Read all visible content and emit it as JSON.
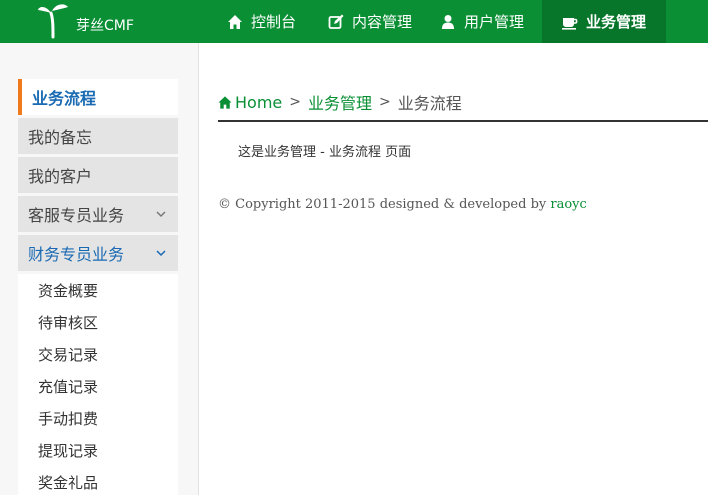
{
  "brand": {
    "name": "芽丝CMF"
  },
  "nav": [
    {
      "label": "控制台",
      "icon": "home-icon"
    },
    {
      "label": "内容管理",
      "icon": "edit-icon"
    },
    {
      "label": "用户管理",
      "icon": "user-icon"
    },
    {
      "label": "业务管理",
      "icon": "coffee-icon",
      "active": true
    }
  ],
  "sidebar": {
    "items": [
      {
        "label": "业务流程",
        "state": "current"
      },
      {
        "label": "我的备忘"
      },
      {
        "label": "我的客户"
      },
      {
        "label": "客服专员业务",
        "expandable": true
      },
      {
        "label": "财务专员业务",
        "expandable": true,
        "open": true
      }
    ],
    "sub_items": [
      "资金概要",
      "待审核区",
      "交易记录",
      "充值记录",
      "手动扣费",
      "提现记录",
      "奖金礼品"
    ]
  },
  "breadcrumb": {
    "home": "Home",
    "section": "业务管理",
    "page": "业务流程",
    "separator": ">"
  },
  "content": {
    "text": "这是业务管理 - 业务流程 页面"
  },
  "footer": {
    "text": "© Copyright 2011-2015 designed & developed by ",
    "author": "raoyc"
  },
  "colors": {
    "primary": "#0a8f34",
    "active_nav": "#07752a",
    "accent": "#f07a1a",
    "link_blue": "#1a6ab3"
  }
}
